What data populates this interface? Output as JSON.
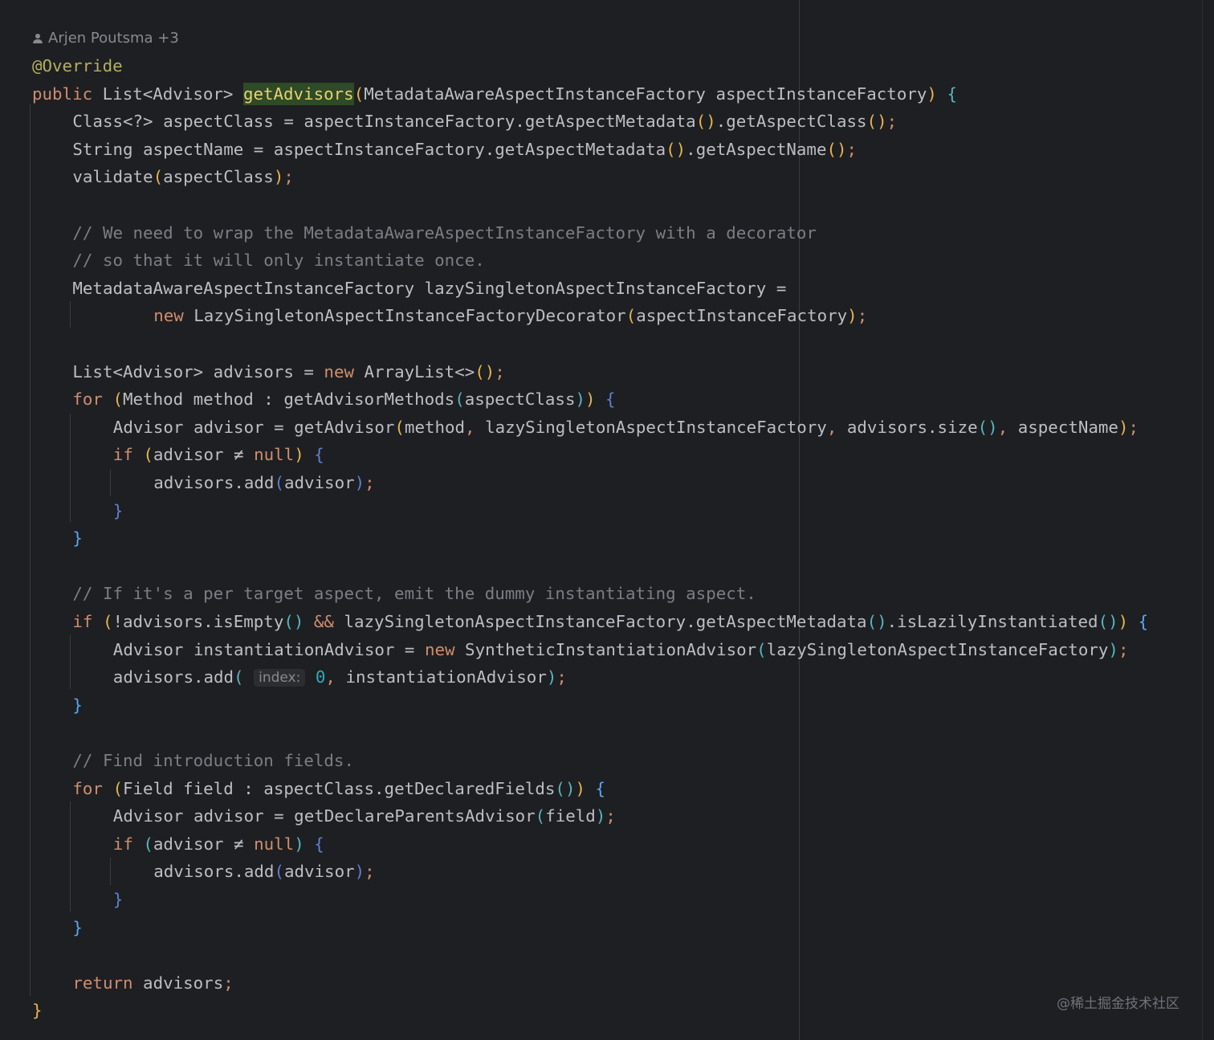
{
  "editor": {
    "author": "Arjen Poutsma +3",
    "author_icon": "user-icon",
    "lines": [
      {
        "indent": 0,
        "tokens": [
          [
            "ann",
            "@Override"
          ]
        ]
      },
      {
        "indent": 0,
        "tokens": [
          [
            "kw",
            "public "
          ],
          [
            "",
            "List<Advisor> "
          ],
          [
            "hl",
            "getAdvisors"
          ],
          [
            "p1",
            "("
          ],
          [
            "",
            "MetadataAwareAspectInstanceFactory aspectInstanceFactory"
          ],
          [
            "p1",
            ")"
          ],
          [
            "",
            ""
          ],
          [
            "p2",
            " {"
          ]
        ]
      },
      {
        "indent": 1,
        "tokens": [
          [
            "",
            "Class<?> aspectClass = aspectInstanceFactory.getAspectMetadata"
          ],
          [
            "p1",
            "()"
          ],
          [
            "",
            ".getAspectClass"
          ],
          [
            "p1",
            "()"
          ],
          [
            "kw",
            ";"
          ]
        ]
      },
      {
        "indent": 1,
        "tokens": [
          [
            "",
            "String aspectName = aspectInstanceFactory.getAspectMetadata"
          ],
          [
            "p1",
            "()"
          ],
          [
            "",
            ".getAspectName"
          ],
          [
            "p1",
            "()"
          ],
          [
            "kw",
            ";"
          ]
        ]
      },
      {
        "indent": 1,
        "tokens": [
          [
            "",
            "validate"
          ],
          [
            "p1",
            "("
          ],
          [
            "",
            "aspectClass"
          ],
          [
            "p1",
            ")"
          ],
          [
            "kw",
            ";"
          ]
        ]
      },
      {
        "indent": 0,
        "tokens": []
      },
      {
        "indent": 1,
        "tokens": [
          [
            "cm",
            "// We need to wrap the MetadataAwareAspectInstanceFactory with a decorator"
          ]
        ]
      },
      {
        "indent": 1,
        "tokens": [
          [
            "cm",
            "// so that it will only instantiate once."
          ]
        ]
      },
      {
        "indent": 1,
        "tokens": [
          [
            "",
            "MetadataAwareAspectInstanceFactory lazySingletonAspectInstanceFactory ="
          ]
        ]
      },
      {
        "indent": 3,
        "tokens": [
          [
            "kw",
            "new "
          ],
          [
            "",
            "LazySingletonAspectInstanceFactoryDecorator"
          ],
          [
            "p1",
            "("
          ],
          [
            "",
            "aspectInstanceFactory"
          ],
          [
            "p1",
            ")"
          ],
          [
            "kw",
            ";"
          ]
        ]
      },
      {
        "indent": 0,
        "tokens": []
      },
      {
        "indent": 1,
        "tokens": [
          [
            "",
            "List<Advisor> advisors = "
          ],
          [
            "kw",
            "new "
          ],
          [
            "",
            "ArrayList<>"
          ],
          [
            "p1",
            "()"
          ],
          [
            "kw",
            ";"
          ]
        ]
      },
      {
        "indent": 1,
        "tokens": [
          [
            "kw",
            "for "
          ],
          [
            "p1",
            "("
          ],
          [
            "",
            "Method method : getAdvisorMethods"
          ],
          [
            "p2",
            "("
          ],
          [
            "",
            "aspectClass"
          ],
          [
            "p2",
            ")"
          ],
          [
            "p1",
            ")"
          ],
          [
            "p3",
            " {"
          ]
        ]
      },
      {
        "indent": 2,
        "tokens": [
          [
            "",
            "Advisor advisor = getAdvisor"
          ],
          [
            "p1",
            "("
          ],
          [
            "",
            "method"
          ],
          [
            "kw",
            ", "
          ],
          [
            "",
            "lazySingletonAspectInstanceFactory"
          ],
          [
            "kw",
            ", "
          ],
          [
            "",
            "advisors.size"
          ],
          [
            "p2",
            "()"
          ],
          [
            "kw",
            ", "
          ],
          [
            "",
            "aspectName"
          ],
          [
            "p1",
            ")"
          ],
          [
            "kw",
            ";"
          ]
        ]
      },
      {
        "indent": 2,
        "tokens": [
          [
            "kw",
            "if "
          ],
          [
            "p1",
            "("
          ],
          [
            "",
            "advisor ≠ "
          ],
          [
            "kw",
            "null"
          ],
          [
            "p1",
            ")"
          ],
          [
            "p3",
            " {"
          ]
        ]
      },
      {
        "indent": 3,
        "tokens": [
          [
            "",
            "advisors.add"
          ],
          [
            "p3",
            "("
          ],
          [
            "",
            "advisor"
          ],
          [
            "p3",
            ")"
          ],
          [
            "kw",
            ";"
          ]
        ]
      },
      {
        "indent": 2,
        "tokens": [
          [
            "p3",
            "}"
          ]
        ]
      },
      {
        "indent": 1,
        "tokens": [
          [
            "fn",
            "}"
          ]
        ]
      },
      {
        "indent": 0,
        "tokens": []
      },
      {
        "indent": 1,
        "tokens": [
          [
            "cm",
            "// If it's a per target aspect, emit the dummy instantiating aspect."
          ]
        ]
      },
      {
        "indent": 1,
        "tokens": [
          [
            "kw",
            "if "
          ],
          [
            "p1",
            "("
          ],
          [
            "",
            "!advisors.isEmpty"
          ],
          [
            "p2",
            "()"
          ],
          [
            "",
            ""
          ],
          [
            "kw",
            " && "
          ],
          [
            "",
            "lazySingletonAspectInstanceFactory.getAspectMetadata"
          ],
          [
            "p2",
            "()"
          ],
          [
            "",
            ".isLazilyInstantiated"
          ],
          [
            "p2",
            "()"
          ],
          [
            "p1",
            ")"
          ],
          [
            "fn",
            " {"
          ]
        ]
      },
      {
        "indent": 2,
        "tokens": [
          [
            "",
            "Advisor instantiationAdvisor = "
          ],
          [
            "kw",
            "new "
          ],
          [
            "",
            "SyntheticInstantiationAdvisor"
          ],
          [
            "p2",
            "("
          ],
          [
            "",
            "lazySingletonAspectInstanceFactory"
          ],
          [
            "p2",
            ")"
          ],
          [
            "kw",
            ";"
          ]
        ]
      },
      {
        "indent": 2,
        "tokens": [
          [
            "",
            "advisors.add"
          ],
          [
            "p2",
            "( "
          ],
          [
            "hint",
            "index:"
          ],
          [
            "num",
            " 0"
          ],
          [
            "kw",
            ", "
          ],
          [
            "",
            "instantiationAdvisor"
          ],
          [
            "p2",
            ")"
          ],
          [
            "kw",
            ";"
          ]
        ]
      },
      {
        "indent": 1,
        "tokens": [
          [
            "fn",
            "}"
          ]
        ]
      },
      {
        "indent": 0,
        "tokens": []
      },
      {
        "indent": 1,
        "tokens": [
          [
            "cm",
            "// Find introduction fields."
          ]
        ]
      },
      {
        "indent": 1,
        "tokens": [
          [
            "kw",
            "for "
          ],
          [
            "p1",
            "("
          ],
          [
            "",
            "Field field : aspectClass.getDeclaredFields"
          ],
          [
            "p2",
            "()"
          ],
          [
            "p1",
            ")"
          ],
          [
            "fn",
            " {"
          ]
        ]
      },
      {
        "indent": 2,
        "tokens": [
          [
            "",
            "Advisor advisor = getDeclareParentsAdvisor"
          ],
          [
            "p2",
            "("
          ],
          [
            "",
            "field"
          ],
          [
            "p2",
            ")"
          ],
          [
            "kw",
            ";"
          ]
        ]
      },
      {
        "indent": 2,
        "tokens": [
          [
            "kw",
            "if "
          ],
          [
            "p2",
            "("
          ],
          [
            "",
            "advisor ≠ "
          ],
          [
            "kw",
            "null"
          ],
          [
            "p2",
            ")"
          ],
          [
            "p3",
            " {"
          ]
        ]
      },
      {
        "indent": 3,
        "tokens": [
          [
            "",
            "advisors.add"
          ],
          [
            "p3",
            "("
          ],
          [
            "",
            "advisor"
          ],
          [
            "p3",
            ")"
          ],
          [
            "kw",
            ";"
          ]
        ]
      },
      {
        "indent": 2,
        "tokens": [
          [
            "p3",
            "}"
          ]
        ]
      },
      {
        "indent": 1,
        "tokens": [
          [
            "fn",
            "}"
          ]
        ]
      },
      {
        "indent": 0,
        "tokens": []
      },
      {
        "indent": 1,
        "tokens": [
          [
            "kw",
            "return "
          ],
          [
            "",
            "advisors"
          ],
          [
            "kw",
            ";"
          ]
        ]
      },
      {
        "indent": 0,
        "tokens": [
          [
            "p1",
            "}"
          ]
        ]
      }
    ]
  },
  "watermark": "@稀土掘金技术社区"
}
